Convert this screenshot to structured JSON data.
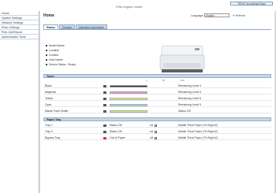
{
  "header": {
    "brand": "Print engine model",
    "top_link": "TEDI/C knowledge Base"
  },
  "sidebar": {
    "items": [
      {
        "label": "Home"
      },
      {
        "label": "System Settings"
      },
      {
        "label": "Network Settings"
      },
      {
        "label": "IPsec Settings"
      },
      {
        "label": "Print Job/Report"
      },
      {
        "label": "Administrator Tools"
      }
    ]
  },
  "main": {
    "title": "Home",
    "language_label": "Language",
    "language_value": "English",
    "refresh_label": "Refresh",
    "tabs": [
      {
        "label": "Status"
      },
      {
        "label": "Counter"
      },
      {
        "label": "Machine Information"
      }
    ],
    "info": [
      {
        "label": "Model Name",
        "value": ""
      },
      {
        "label": "Location",
        "value": ""
      },
      {
        "label": "Contact",
        "value": ""
      },
      {
        "label": "Host Name",
        "value": ""
      },
      {
        "label": "Device Status",
        "value": "Ready"
      }
    ],
    "toner_title": "Toner",
    "toner_scale": [
      "0",
      "50",
      "100"
    ],
    "toner": [
      {
        "name": "Black",
        "level": 1.0,
        "color": "#222222",
        "status": "Remaining Level 4"
      },
      {
        "name": "Magenta",
        "level": 1.0,
        "color": "#ff7fd6",
        "status": "Remaining Level 5"
      },
      {
        "name": "Yellow",
        "level": 1.0,
        "color": "#fbf27a",
        "status": "Remaining Level 5"
      },
      {
        "name": "Cyan",
        "level": 1.0,
        "color": "#84ecf3",
        "status": "Remaining Level 5"
      },
      {
        "name": "Waste Toner Bottle",
        "level": 1.0,
        "color": "#c7ef80",
        "status": "Status OK"
      }
    ],
    "paper_title": "Paper Tray",
    "paper": [
      {
        "name": "Tray 1",
        "status": "Status OK",
        "size": "A4",
        "type": "Middle Thick Paper (75-90g/m2)",
        "error": false
      },
      {
        "name": "Tray 2",
        "status": "Status OK",
        "size": "A4",
        "type": "Middle Thick Paper (75-90g/m2)",
        "error": false
      },
      {
        "name": "Bypass Tray",
        "status": "Out of Paper",
        "size": "A4",
        "type": "Middle Thick Paper (75-90g/m2)",
        "error": true
      }
    ]
  }
}
